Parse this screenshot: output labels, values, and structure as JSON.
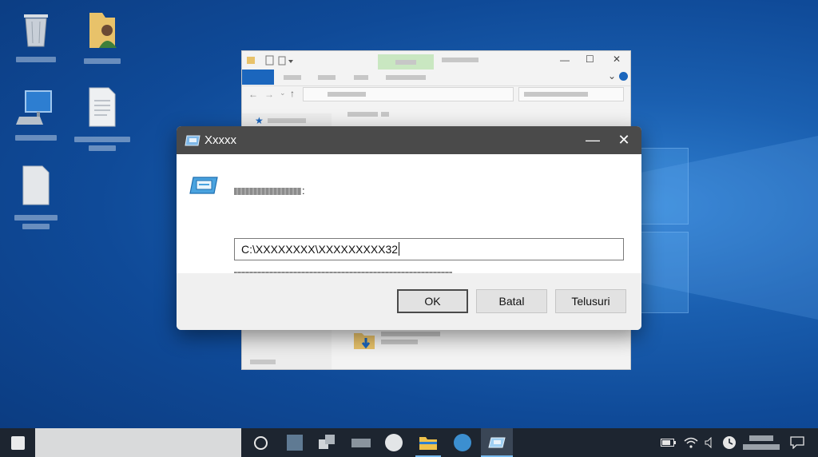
{
  "dialog": {
    "title": "Xxxxx",
    "prompt_colon": ":",
    "description_end": ".",
    "open_value": "C:\\XXXXXXXX\\XXXXXXXXX32",
    "buttons": {
      "ok": "OK",
      "cancel": "Batal",
      "browse": "Telusuri"
    },
    "minimize_glyph": "—",
    "close_glyph": "✕"
  },
  "explorer": {
    "minimize_glyph": "—",
    "maximize_glyph": "☐",
    "close_glyph": "✕",
    "help_glyph": "⌄"
  },
  "icons": {
    "dialog_app": "run-icon",
    "desktop": [
      "recycle-bin-icon",
      "user-folder-icon",
      "computer-icon",
      "document-icon",
      "file-icon"
    ],
    "taskbar": [
      "start-icon",
      "cortana-icon",
      "task-view-icon",
      "file-explorer-icon",
      "run-icon"
    ],
    "tray": [
      "battery-icon",
      "wifi-icon",
      "volume-icon",
      "clock-icon",
      "notification-icon"
    ]
  },
  "colors": {
    "dialog_titlebar": "#4a4a4a",
    "taskbar": "#1d2530",
    "explorer_file_tab": "#1b66bd",
    "explorer_green_tab": "#c9e7c1"
  }
}
